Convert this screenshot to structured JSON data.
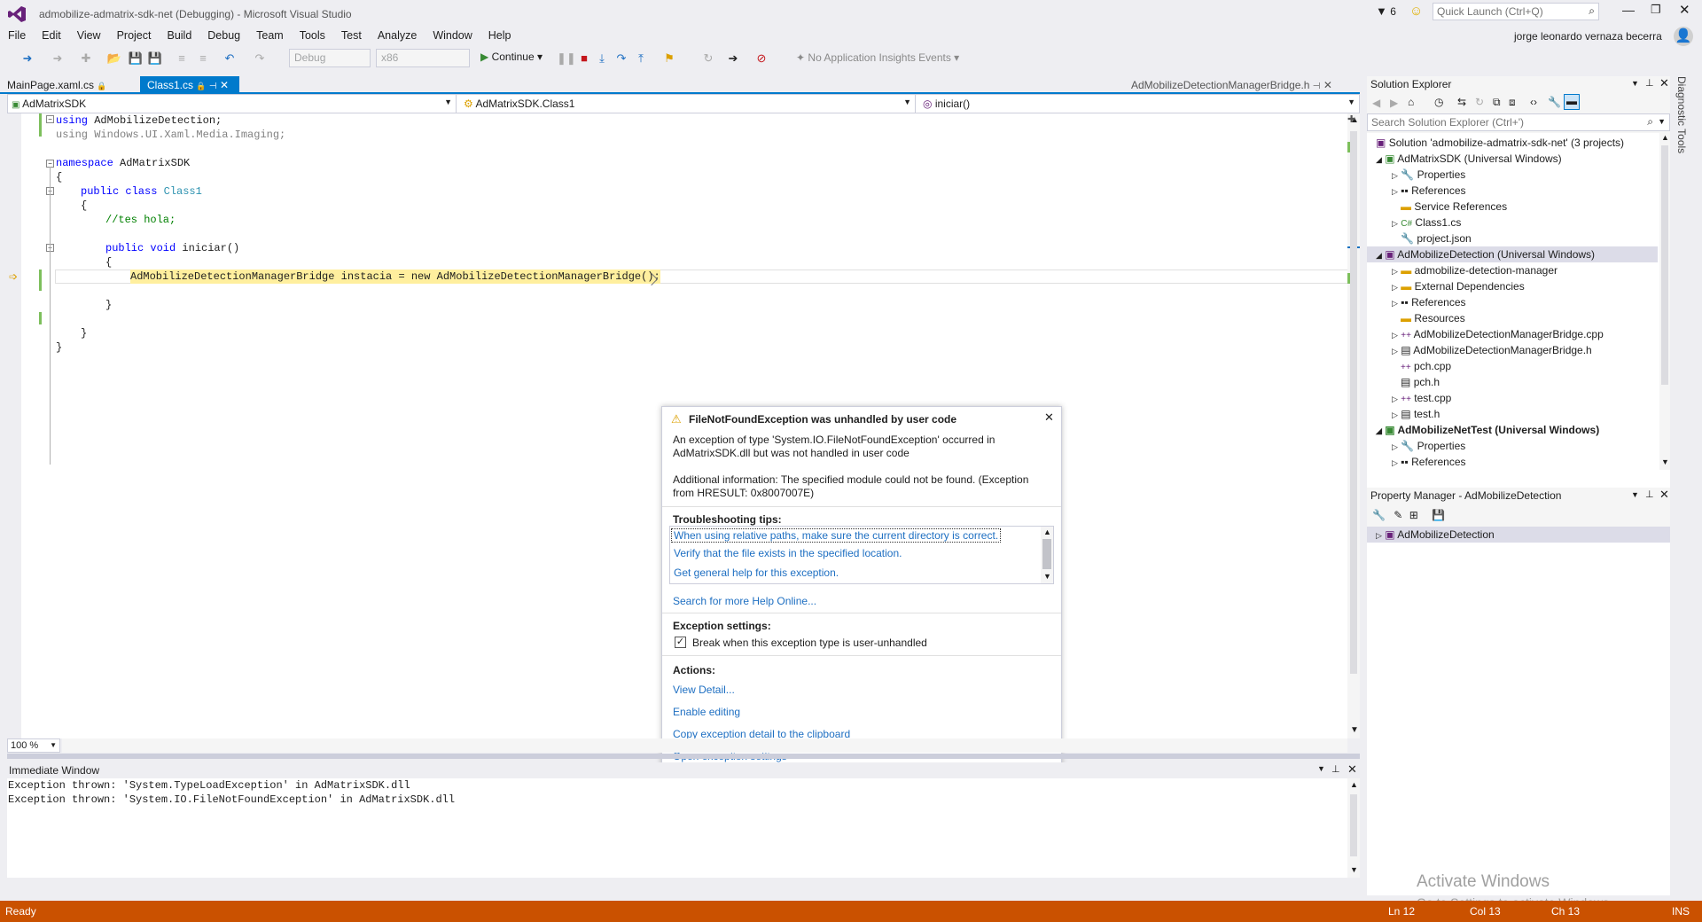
{
  "window": {
    "title": "admobilize-admatrix-sdk-net (Debugging) - Microsoft Visual Studio",
    "filter_count": "6",
    "quick_launch_placeholder": "Quick Launch (Ctrl+Q)",
    "user": "jorge leonardo vernaza becerra"
  },
  "menu": [
    "File",
    "Edit",
    "View",
    "Project",
    "Build",
    "Debug",
    "Team",
    "Tools",
    "Test",
    "Analyze",
    "Window",
    "Help"
  ],
  "toolbar": {
    "config": "Debug",
    "platform": "x86",
    "continue": "Continue",
    "insights": "No Application Insights Events"
  },
  "tabs": {
    "tab1": "MainPage.xaml.cs",
    "tab2": "Class1.cs",
    "tab_right": "AdMobilizeDetectionManagerBridge.h"
  },
  "nav": {
    "project": "AdMatrixSDK",
    "class": "AdMatrixSDK.Class1",
    "member": "iniciar()"
  },
  "code": {
    "l1_kw": "using",
    "l1_rest": " AdMobilizeDetection;",
    "l2_kw": "using",
    "l2_rest": " Windows.UI.Xaml.Media.Imaging;",
    "l3_kw": "namespace",
    "l3_rest": " AdMatrixSDK",
    "l4": "{",
    "l5_kw": "public class",
    "l5_ty": "Class1",
    "l6": "{",
    "l7": "//tes hola;",
    "l8_kw": "public void",
    "l8_rest": " iniciar()",
    "l9": "{",
    "l10": "AdMobilizeDetectionManagerBridge instacia = new AdMobilizeDetectionManagerBridge();",
    "l11": "}",
    "l12": "}",
    "l13": "}"
  },
  "zoom": "100 %",
  "exception": {
    "title": "FileNotFoundException was unhandled by user code",
    "msg1": "An exception of type 'System.IO.FileNotFoundException' occurred in AdMatrixSDK.dll but was not handled in user code",
    "msg2": "Additional information: The specified module could not be found. (Exception from HRESULT: 0x8007007E)",
    "tips_header": "Troubleshooting tips:",
    "tips": [
      "When using relative paths, make sure the current directory is correct.",
      "Verify that the file exists in the specified location.",
      "Get general help for this exception."
    ],
    "search_help": "Search for more Help Online...",
    "settings_header": "Exception settings:",
    "checkbox": "Break when this exception type is user-unhandled",
    "actions_header": "Actions:",
    "actions": [
      "View Detail...",
      "Enable editing",
      "Copy exception detail to the clipboard",
      "Open exception settings"
    ]
  },
  "immediate": {
    "title": "Immediate Window",
    "lines": [
      "Exception thrown: 'System.TypeLoadException' in AdMatrixSDK.dll",
      "Exception thrown: 'System.IO.FileNotFoundException' in AdMatrixSDK.dll"
    ]
  },
  "solution_explorer": {
    "title": "Solution Explorer",
    "search_placeholder": "Search Solution Explorer (Ctrl+')",
    "items": [
      "Solution 'admobilize-admatrix-sdk-net' (3 projects)",
      "AdMatrixSDK (Universal Windows)",
      "Properties",
      "References",
      "Service References",
      "Class1.cs",
      "project.json",
      "AdMobilizeDetection (Universal Windows)",
      "admobilize-detection-manager",
      "External Dependencies",
      "References",
      "Resources",
      "AdMobilizeDetectionManagerBridge.cpp",
      "AdMobilizeDetectionManagerBridge.h",
      "pch.cpp",
      "pch.h",
      "test.cpp",
      "test.h",
      "AdMobilizeNetTest (Universal Windows)",
      "Properties",
      "References"
    ]
  },
  "property_manager": {
    "title": "Property Manager - AdMobilizeDetection",
    "item": "AdMobilizeDetection"
  },
  "side_tab": "Diagnostic Tools",
  "watermark": {
    "line1": "Activate Windows",
    "line2": "Go to Settings to activate Windows."
  },
  "status": {
    "ready": "Ready",
    "ln": "Ln 12",
    "col": "Col 13",
    "ch": "Ch 13",
    "ins": "INS"
  },
  "colors": {
    "status": "#ca5100",
    "accent": "#007acc",
    "link": "#1e6fc2"
  }
}
